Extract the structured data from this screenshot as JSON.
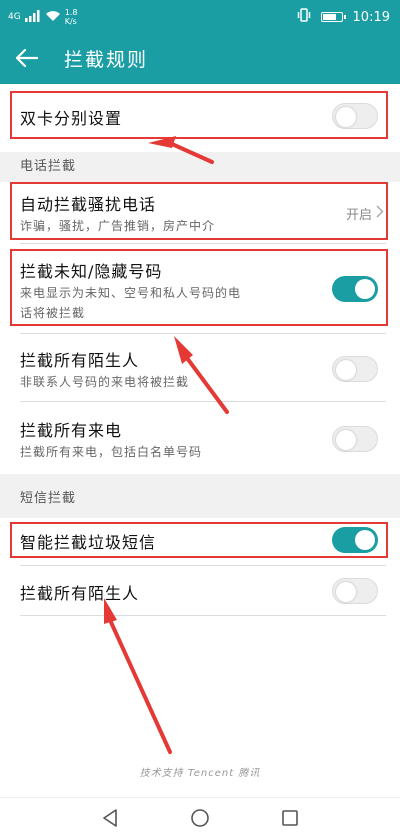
{
  "status_bar": {
    "network": "4G",
    "speed_value": "1.8",
    "speed_unit": "K/s",
    "time": "10:19",
    "battery_level": 0.8
  },
  "app_bar": {
    "title": "拦截规则"
  },
  "dual_sim_row": {
    "title": "双卡分别设置",
    "enabled": false
  },
  "calls_section": {
    "label": "电话拦截"
  },
  "auto_intercept_row": {
    "title": "自动拦截骚扰电话",
    "subtitle": "诈骗，骚扰，广告推销，房产中介",
    "value": "开启"
  },
  "unknown_row": {
    "title": "拦截未知/隐藏号码",
    "subtitle_line1": "来电显示为未知、空号和私人号码的电",
    "subtitle_line2": "话将被拦截",
    "enabled": true
  },
  "strangers_row": {
    "title": "拦截所有陌生人",
    "subtitle": "非联系人号码的来电将被拦截",
    "enabled": false
  },
  "all_calls_row": {
    "title": "拦截所有来电",
    "subtitle": "拦截所有来电，包括白名单号码",
    "enabled": false
  },
  "sms_section": {
    "label": "短信拦截"
  },
  "smart_sms_row": {
    "title": "智能拦截垃圾短信",
    "enabled": true
  },
  "sms_strangers_row": {
    "title": "拦截所有陌生人",
    "enabled": false
  },
  "footer": {
    "text": "技术支持 Tencent 腾讯"
  },
  "colors": {
    "accent": "#1a9ea3",
    "annotation_red": "#e53935",
    "section_bg": "#f1f1f1"
  }
}
